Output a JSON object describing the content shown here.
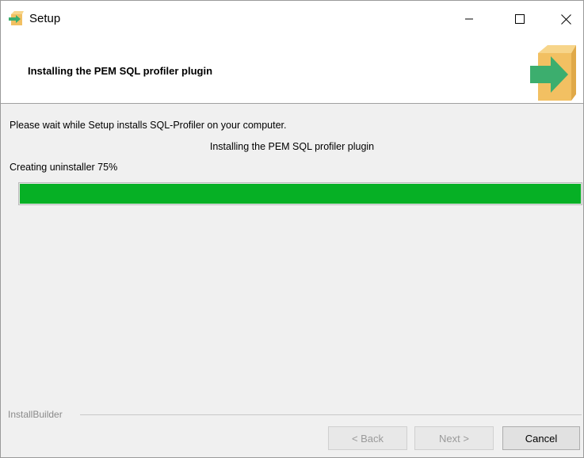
{
  "window": {
    "title": "Setup",
    "icon": "setup-box-arrow-icon"
  },
  "header": {
    "title": "Installing the PEM SQL profiler plugin",
    "icon": "install-box-arrow-icon"
  },
  "body": {
    "wait_message": "Please wait while Setup installs SQL-Profiler on your computer.",
    "status": "Installing the PEM SQL profiler plugin",
    "progress_label": "Creating uninstaller 75%",
    "progress_percent": 100
  },
  "footer": {
    "brand": "InstallBuilder",
    "back_label": "< Back",
    "next_label": "Next >",
    "cancel_label": "Cancel"
  },
  "colors": {
    "progress": "#06b025",
    "header_arrow": "#3cae6e",
    "box": "#f2c062"
  }
}
